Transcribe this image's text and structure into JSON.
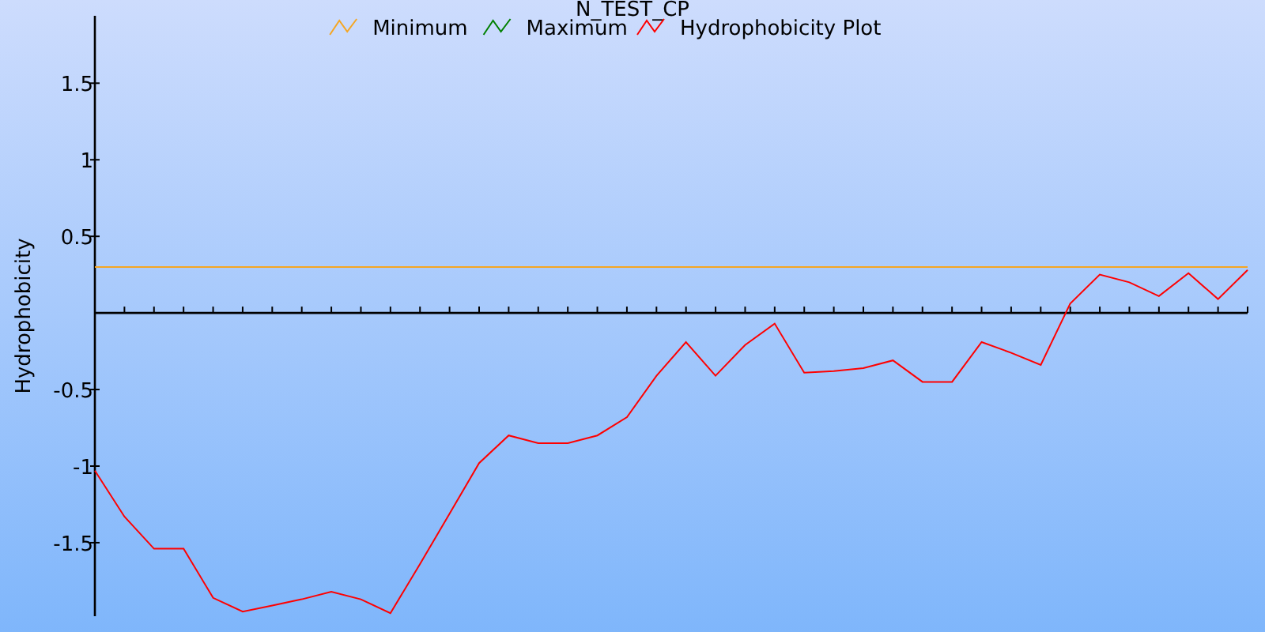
{
  "chart_data": {
    "type": "line",
    "title": "N_TEST_CP",
    "legend": "top",
    "ylabel": "Hydrophobicity",
    "categories": [
      null,
      null,
      null,
      null,
      null,
      null,
      null,
      null,
      null,
      null,
      null,
      null,
      null,
      null,
      null,
      null,
      null,
      null,
      null,
      null,
      null,
      null,
      null,
      null,
      null,
      null,
      null,
      null,
      null,
      null,
      null,
      null,
      null,
      null,
      null,
      null,
      null,
      null,
      null,
      null
    ],
    "ylim": [
      -1.98,
      1.94
    ],
    "yticks": [
      {
        "value": -1.5,
        "label": "-1.5"
      },
      {
        "value": -1,
        "label": "-1"
      },
      {
        "value": -0.5,
        "label": "-0.5"
      },
      {
        "value": 0.5,
        "label": "0.5"
      },
      {
        "value": 1,
        "label": "1"
      },
      {
        "value": 1.5,
        "label": "1.5"
      }
    ],
    "series": [
      {
        "name": "Minimum",
        "color": "#f5a623",
        "values": [
          0.3,
          0.3,
          0.3,
          0.3,
          0.3,
          0.3,
          0.3,
          0.3,
          0.3,
          0.3,
          0.3,
          0.3,
          0.3,
          0.3,
          0.3,
          0.3,
          0.3,
          0.3,
          0.3,
          0.3,
          0.3,
          0.3,
          0.3,
          0.3,
          0.3,
          0.3,
          0.3,
          0.3,
          0.3,
          0.3,
          0.3,
          0.3,
          0.3,
          0.3,
          0.3,
          0.3,
          0.3,
          0.3,
          0.3,
          0.3
        ]
      },
      {
        "name": "Maximum",
        "color": "#008000",
        "values": [
          null,
          null,
          null,
          null,
          null,
          null,
          null,
          null,
          null,
          null,
          null,
          null,
          null,
          null,
          null,
          null,
          null,
          null,
          null,
          null,
          null,
          null,
          null,
          null,
          null,
          null,
          null,
          null,
          null,
          null,
          null,
          null,
          null,
          null,
          null,
          null,
          null,
          null,
          null,
          null
        ]
      },
      {
        "name": "Hydrophobicity Plot",
        "color": "#ff0000",
        "values": [
          -1.03,
          -1.33,
          -1.54,
          -1.54,
          -1.86,
          -1.95,
          -1.91,
          -1.87,
          -1.82,
          -1.87,
          -1.96,
          -1.64,
          -1.31,
          -0.98,
          -0.8,
          -0.85,
          -0.85,
          -0.8,
          -0.68,
          -0.41,
          -0.19,
          -0.41,
          -0.21,
          -0.07,
          -0.39,
          -0.38,
          -0.36,
          -0.31,
          -0.45,
          -0.45,
          -0.19,
          -0.26,
          -0.34,
          0.06,
          0.25,
          0.2,
          0.11,
          0.26,
          0.09,
          0.28
        ]
      }
    ]
  }
}
